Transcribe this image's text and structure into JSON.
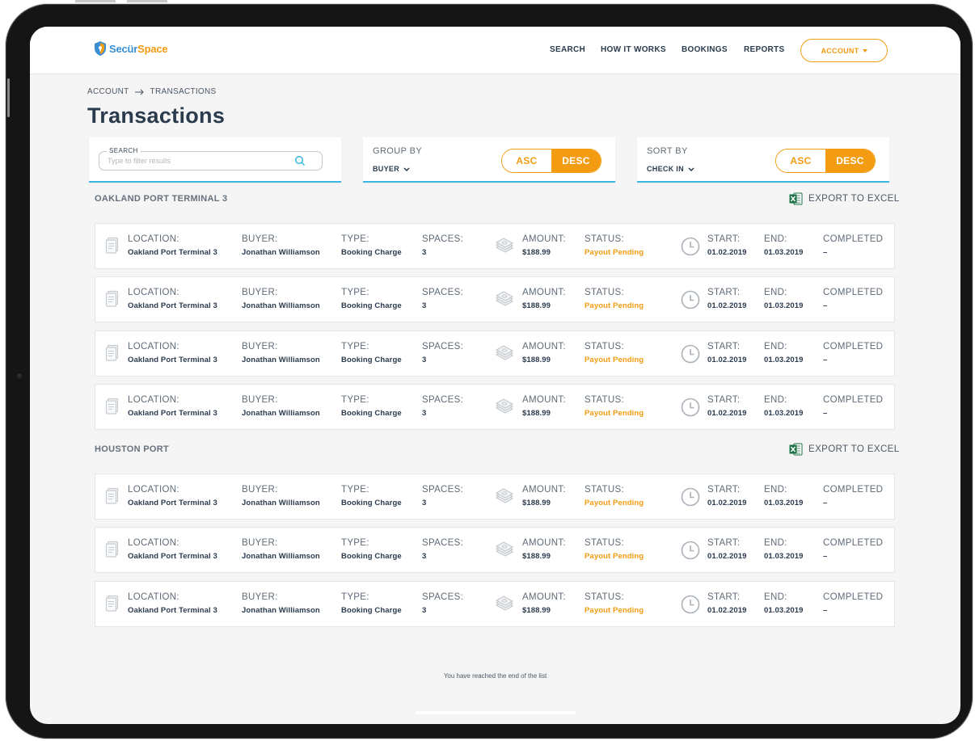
{
  "header": {
    "logo": {
      "part1": "Secür",
      "part2": "Space"
    },
    "nav": [
      "SEARCH",
      "HOW IT WORKS",
      "BOOKINGS",
      "REPORTS"
    ],
    "account_label": "ACCOUNT"
  },
  "breadcrumb": {
    "parent": "ACCOUNT",
    "current": "TRANSACTIONS"
  },
  "page_title": "Transactions",
  "filters": {
    "search": {
      "label": "SEARCH",
      "placeholder": "Type to filter results",
      "value": ""
    },
    "group_by": {
      "label": "GROUP BY",
      "value": "BUYER",
      "asc": "ASC",
      "desc": "DESC",
      "selected": "DESC"
    },
    "sort_by": {
      "label": "SORT BY",
      "value": "CHECK IN",
      "asc": "ASC",
      "desc": "DESC",
      "selected": "DESC"
    }
  },
  "labels": {
    "location": "LOCATION:",
    "buyer": "BUYER:",
    "type": "TYPE:",
    "spaces": "SPACES:",
    "amount": "AMOUNT:",
    "status": "STATUS:",
    "start": "START:",
    "end": "END:",
    "completed": "COMPLETED",
    "export": "EXPORT TO EXCEL"
  },
  "groups": [
    {
      "title": "OAKLAND PORT TERMINAL 3",
      "rows": [
        {
          "location": "Oakland Port Terminal 3",
          "buyer": "Jonathan Williamson",
          "type": "Booking Charge",
          "spaces": "3",
          "amount": "$188.99",
          "status": "Payout Pending",
          "start": "01.02.2019",
          "end": "01.03.2019",
          "completed": "–"
        },
        {
          "location": "Oakland Port Terminal 3",
          "buyer": "Jonathan Williamson",
          "type": "Booking Charge",
          "spaces": "3",
          "amount": "$188.99",
          "status": "Payout Pending",
          "start": "01.02.2019",
          "end": "01.03.2019",
          "completed": "–"
        },
        {
          "location": "Oakland Port Terminal 3",
          "buyer": "Jonathan Williamson",
          "type": "Booking Charge",
          "spaces": "3",
          "amount": "$188.99",
          "status": "Payout Pending",
          "start": "01.02.2019",
          "end": "01.03.2019",
          "completed": "–"
        },
        {
          "location": "Oakland Port Terminal 3",
          "buyer": "Jonathan Williamson",
          "type": "Booking Charge",
          "spaces": "3",
          "amount": "$188.99",
          "status": "Payout Pending",
          "start": "01.02.2019",
          "end": "01.03.2019",
          "completed": "–"
        }
      ]
    },
    {
      "title": "HOUSTON PORT",
      "rows": [
        {
          "location": "Oakland Port Terminal 3",
          "buyer": "Jonathan Williamson",
          "type": "Booking Charge",
          "spaces": "3",
          "amount": "$188.99",
          "status": "Payout Pending",
          "start": "01.02.2019",
          "end": "01.03.2019",
          "completed": "–"
        },
        {
          "location": "Oakland Port Terminal 3",
          "buyer": "Jonathan Williamson",
          "type": "Booking Charge",
          "spaces": "3",
          "amount": "$188.99",
          "status": "Payout Pending",
          "start": "01.02.2019",
          "end": "01.03.2019",
          "completed": "–"
        },
        {
          "location": "Oakland Port Terminal 3",
          "buyer": "Jonathan Williamson",
          "type": "Booking Charge",
          "spaces": "3",
          "amount": "$188.99",
          "status": "Payout Pending",
          "start": "01.02.2019",
          "end": "01.03.2019",
          "completed": "–"
        }
      ]
    }
  ],
  "end_message": "You have reached the end of the list",
  "icons": {
    "document": "document-icon",
    "money": "money-stack-icon",
    "clock": "clock-icon",
    "excel": "excel-icon",
    "search": "search-icon",
    "chevron": "chevron-down-icon"
  },
  "colors": {
    "accent": "#f39c12",
    "brand_blue": "#3a8fd3",
    "underline": "#3ab7e0",
    "text_dark": "#2b3b4e"
  }
}
